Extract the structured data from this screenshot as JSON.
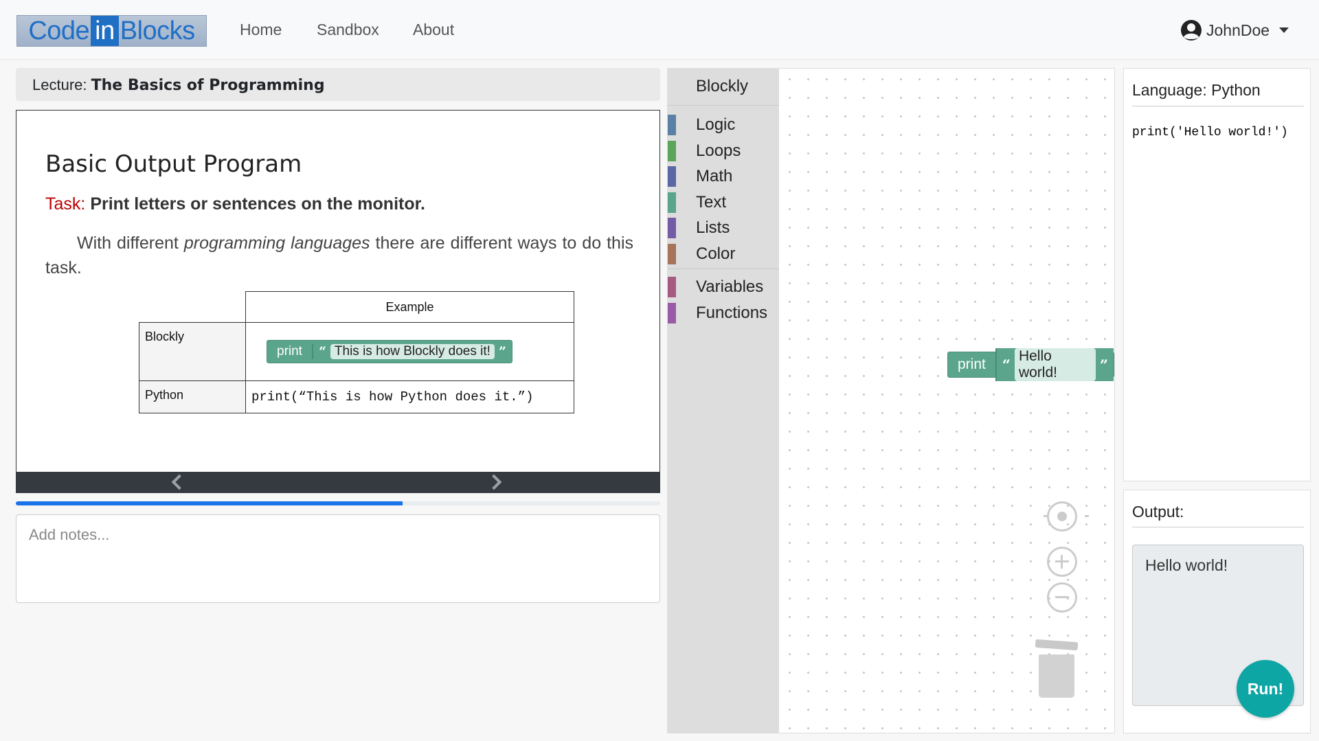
{
  "app": {
    "logo": {
      "left": "Code",
      "middle": "in",
      "right": "Blocks"
    }
  },
  "nav": {
    "home": "Home",
    "sandbox": "Sandbox",
    "about": "About",
    "user": "JohnDoe"
  },
  "lecture": {
    "prefix": "Lecture:",
    "title": "The Basics of Programming",
    "slide": {
      "title": "Basic Output Program",
      "task_label": "Task:",
      "task_text": "Print letters or sentences on the monitor.",
      "para_before": "With different ",
      "para_italic": "programming languages",
      "para_after": " there are different ways to do this task.",
      "table": {
        "header": "Example",
        "row1_label": "Blockly",
        "row1_block_keyword": "print",
        "row1_block_text": "This is how Blockly does it!",
        "row2_label": "Python",
        "row2_code": "print(“This is how Python does it.”)"
      }
    },
    "progress_fraction": 0.6,
    "notes_placeholder": "Add notes..."
  },
  "blockly": {
    "toolbox_title": "Blockly",
    "categories": [
      {
        "label": "Logic",
        "color": "#5b80a5"
      },
      {
        "label": "Loops",
        "color": "#5ba55b"
      },
      {
        "label": "Math",
        "color": "#5b67a5"
      },
      {
        "label": "Text",
        "color": "#5ba58c"
      },
      {
        "label": "Lists",
        "color": "#745ba5"
      },
      {
        "label": "Color",
        "color": "#a5745b"
      },
      {
        "label": "Variables",
        "color": "#a55b80"
      },
      {
        "label": "Functions",
        "color": "#995ba5"
      }
    ],
    "workspace_block": {
      "keyword": "print",
      "text": "Hello world!"
    }
  },
  "code": {
    "title": "Language: Python",
    "source": "print('Hello world!')"
  },
  "output": {
    "title": "Output:",
    "text": "Hello world!",
    "run_label": "Run!"
  }
}
